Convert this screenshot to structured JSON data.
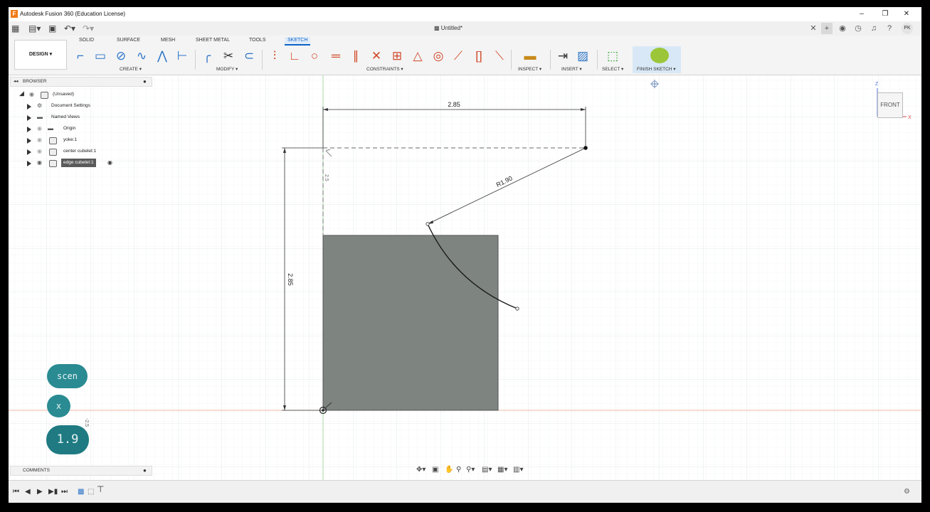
{
  "window": {
    "title": "Autodesk Fusion 360 (Education License)",
    "app_icon_letter": "F",
    "minimize": "–",
    "restore": "❐",
    "close": "✕"
  },
  "quickbar": {
    "doc_title": "Untitled*",
    "tab_close": "✕",
    "new_tab": "+",
    "user_initials": "PK"
  },
  "ribbon": {
    "workspace": "DESIGN ▾",
    "tabs": [
      "SOLID",
      "SURFACE",
      "MESH",
      "SHEET METAL",
      "TOOLS",
      "SKETCH"
    ],
    "active_tab": "SKETCH",
    "groups": {
      "create": "CREATE ▾",
      "modify": "MODIFY ▾",
      "constraints": "CONSTRAINTS ▾",
      "inspect": "INSPECT ▾",
      "insert": "INSERT ▾",
      "select": "SELECT ▾",
      "finish": "FINISH SKETCH ▾"
    }
  },
  "browser": {
    "title": "BROWSER",
    "items": [
      {
        "label": "(Unsaved)"
      },
      {
        "label": "Document Settings"
      },
      {
        "label": "Named Views"
      },
      {
        "label": "Origin"
      },
      {
        "label": "yoke:1"
      },
      {
        "label": "center cubelet:1"
      },
      {
        "label": "edge cubelet:1"
      }
    ]
  },
  "comments": {
    "title": "COMMENTS"
  },
  "sketch": {
    "dim_horizontal": "2.85",
    "dim_vertical": "2.85",
    "dim_radius": "R1.90",
    "dim_small_a": "2.5",
    "dim_small_b": "-2.5",
    "colors": {
      "profile_fill": "#7e8480",
      "grid_line": "#e6eaec",
      "axis_red": "#e8a08a",
      "axis_green": "#9fd39f"
    }
  },
  "overlays": {
    "bubble_1": "scen",
    "bubble_2": "x",
    "bubble_3": "1.9"
  },
  "viewcube": {
    "face": "FRONT",
    "axis_z": "Z",
    "axis_x": "X"
  }
}
